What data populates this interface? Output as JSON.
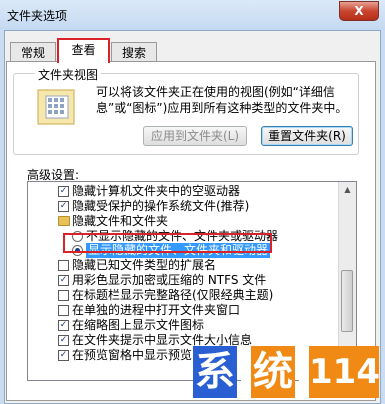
{
  "window": {
    "title": "文件夹选项",
    "close_label": "X"
  },
  "tabs": [
    {
      "label": "常规"
    },
    {
      "label": "查看"
    },
    {
      "label": "搜索"
    }
  ],
  "folder_view": {
    "label": "文件夹视图",
    "description_line1": "可以将该文件夹正在使用的视图(例如“详细信",
    "description_line2": "息”或“图标”)应用到所有这种类型的文件夹中。",
    "apply_button": "应用到文件夹(L)",
    "reset_button": "重置文件夹(R)"
  },
  "advanced": {
    "label": "高级设置:",
    "items": [
      {
        "text": "隐藏计算机文件夹中的空驱动器",
        "kind": "checkbox",
        "checked": true
      },
      {
        "text": "隐藏受保护的操作系统文件(推荐)",
        "kind": "checkbox",
        "checked": true
      },
      {
        "text": "隐藏文件和文件夹",
        "kind": "folder"
      },
      {
        "text": "不显示隐藏的文件、文件夹或驱动器",
        "kind": "radio",
        "checked": false
      },
      {
        "text": "显示隐藏的文件、文件夹和驱动器",
        "kind": "radio",
        "checked": true,
        "selected": true
      },
      {
        "text": "隐藏已知文件类型的扩展名",
        "kind": "checkbox",
        "checked": false
      },
      {
        "text": "用彩色显示加密或压缩的 NTFS 文件",
        "kind": "checkbox",
        "checked": true
      },
      {
        "text": "在标题栏显示完整路径(仅限经典主题)",
        "kind": "checkbox",
        "checked": false
      },
      {
        "text": "在单独的进程中打开文件夹窗口",
        "kind": "checkbox",
        "checked": false
      },
      {
        "text": "在缩略图上显示文件图标",
        "kind": "checkbox",
        "checked": true
      },
      {
        "text": "在文件夹提示中显示文件大小信息",
        "kind": "checkbox",
        "checked": true
      },
      {
        "text": "在预览窗格中显示预览",
        "kind": "checkbox",
        "checked": true
      }
    ]
  },
  "watermark": {
    "chars": [
      "系",
      "统",
      "114"
    ],
    "colors": {
      "blue": "#2a5fd4",
      "orange": "#f08a14",
      "white": "#ffffff"
    }
  }
}
